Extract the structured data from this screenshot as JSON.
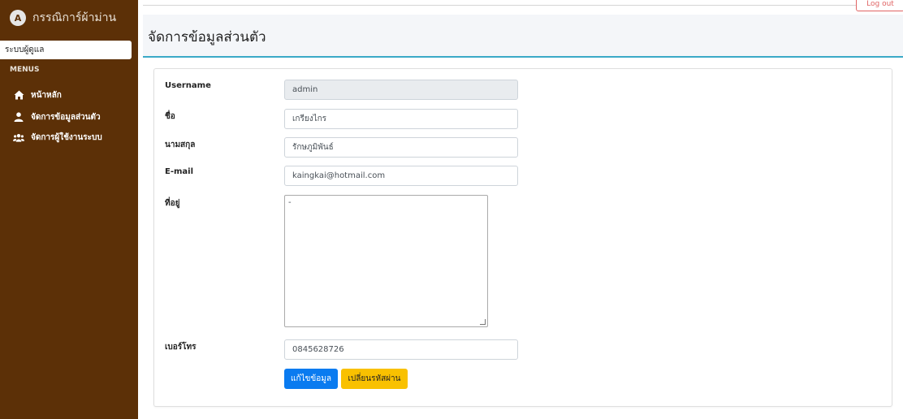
{
  "sidebar": {
    "brand_initial": "A",
    "brand_text": "กรรณิการ์ผ้าม่าน",
    "user_role": "ระบบผู้ดูแล",
    "menus_label": "MENUS",
    "items": [
      {
        "label": "หน้าหลัก",
        "icon": "home-icon"
      },
      {
        "label": "จัดการข้อมูลส่วนตัว",
        "icon": "user-icon"
      },
      {
        "label": "จัดการผู้ใช้งานระบบ",
        "icon": "users-icon"
      }
    ]
  },
  "topbar": {
    "logout_label": "Log out"
  },
  "header": {
    "title": "จัดการข้อมูลส่วนตัว"
  },
  "form": {
    "username_label": "Username",
    "username_value": "admin",
    "firstname_label": "ชื่อ",
    "firstname_value": "เกรียงไกร",
    "lastname_label": "นามสกุล",
    "lastname_value": "รักษภูมิพันธ์",
    "email_label": "E-mail",
    "email_value": "kaingkai@hotmail.com",
    "address_label": "ที่อยู่",
    "address_value": "-",
    "phone_label": "เบอร์โทร",
    "phone_value": "0845628726",
    "edit_button": "แก้ไขข้อมูล",
    "change_password_button": "เปลี่ยนรหัสผ่าน"
  },
  "colors": {
    "sidebar_bg": "#5c3007",
    "header_accent": "#3aa9c7",
    "primary": "#0a7bf0",
    "warning": "#f9c100",
    "logout": "#e06464"
  }
}
